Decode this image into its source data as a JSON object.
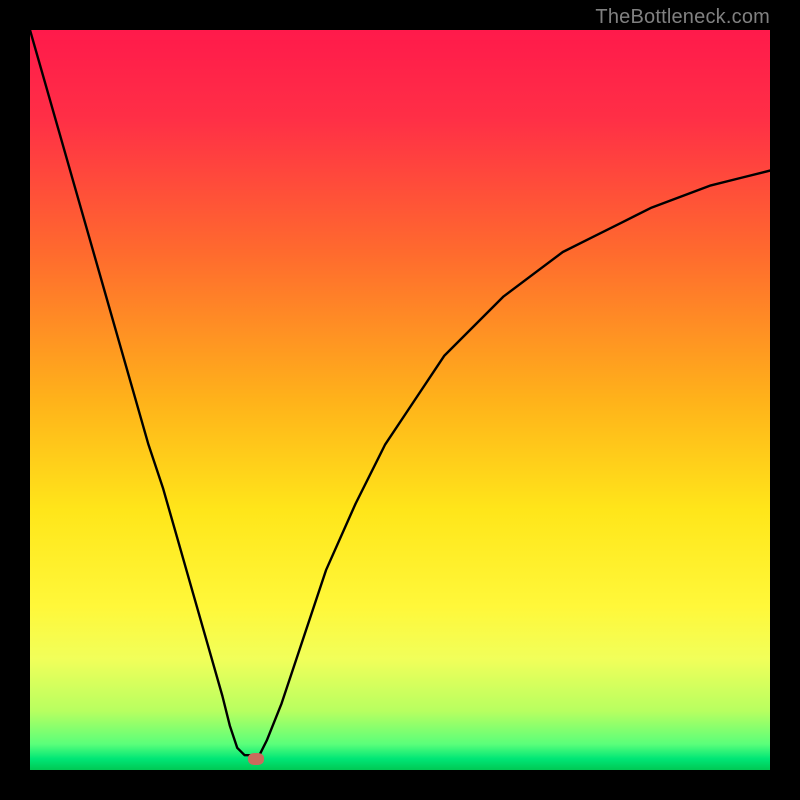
{
  "watermark": "TheBottleneck.com",
  "chart_data": {
    "type": "line",
    "title": "",
    "xlabel": "",
    "ylabel": "",
    "xlim": [
      0,
      100
    ],
    "ylim": [
      0,
      100
    ],
    "grid": false,
    "legend": false,
    "gradient_stops": [
      {
        "offset": 0.0,
        "color": "#ff1a4b"
      },
      {
        "offset": 0.12,
        "color": "#ff2f46"
      },
      {
        "offset": 0.3,
        "color": "#ff6a2e"
      },
      {
        "offset": 0.5,
        "color": "#ffb21a"
      },
      {
        "offset": 0.65,
        "color": "#ffe61a"
      },
      {
        "offset": 0.78,
        "color": "#fff83a"
      },
      {
        "offset": 0.85,
        "color": "#f1ff5a"
      },
      {
        "offset": 0.92,
        "color": "#b8ff60"
      },
      {
        "offset": 0.965,
        "color": "#5aff7a"
      },
      {
        "offset": 0.985,
        "color": "#00e676"
      },
      {
        "offset": 1.0,
        "color": "#00c853"
      }
    ],
    "series": [
      {
        "name": "bottleneck-curve",
        "color": "#000000",
        "x": [
          0,
          2,
          4,
          6,
          8,
          10,
          12,
          14,
          16,
          18,
          20,
          22,
          24,
          26,
          27,
          28,
          29,
          30,
          31,
          32,
          34,
          36,
          38,
          40,
          44,
          48,
          52,
          56,
          60,
          64,
          68,
          72,
          76,
          80,
          84,
          88,
          92,
          96,
          100
        ],
        "y": [
          100,
          93,
          86,
          79,
          72,
          65,
          58,
          51,
          44,
          38,
          31,
          24,
          17,
          10,
          6,
          3,
          2,
          2,
          2,
          4,
          9,
          15,
          21,
          27,
          36,
          44,
          50,
          56,
          60,
          64,
          67,
          70,
          72,
          74,
          76,
          77.5,
          79,
          80,
          81
        ]
      }
    ],
    "marker": {
      "name": "min-point",
      "x": 30.5,
      "y": 1.5,
      "color": "#c96b5c"
    }
  }
}
